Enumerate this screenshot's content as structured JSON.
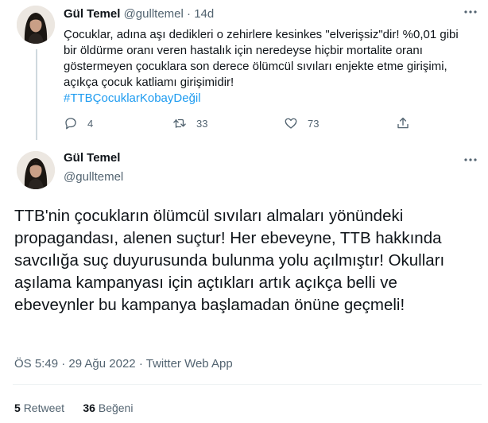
{
  "reply_tweet": {
    "author_name": "Gül Temel",
    "handle": "@gulltemel",
    "separator": "·",
    "age": "14d",
    "text_lines": [
      "Çocuklar, adına aşı dedikleri o zehirlere kesinkes \"elverişsiz\"dir! %0,01 gibi",
      "bir öldürme oranı veren hastalık için neredeyse hiçbir mortalite oranı",
      "göstermeyen çocuklara son derece ölümcül sıvıları enjekte etme girişimi,",
      "açıkça çocuk katliamı girişimidir!"
    ],
    "hashtag": "#TTBÇocuklarKobayDeğil",
    "actions": {
      "replies": "4",
      "retweets": "33",
      "likes": "73"
    },
    "icons": [
      "reply-icon",
      "retweet-icon",
      "like-icon",
      "share-icon",
      "more-icon"
    ]
  },
  "main_tweet": {
    "author_name": "Gül Temel",
    "handle": "@gulltemel",
    "text": "TTB'nin çocukların ölümcül sıvıları almaları yönündeki propagandası, alenen suçtur! Her ebeveyne, TTB hakkında savcılığa suç duyurusunda bulunma yolu açılmıştır! Okulları aşılama kampanyası için açtıkları artık açıkça belli ve ebeveynler bu kampanya başlamadan önüne geçmeli!",
    "time": "ÖS 5:49",
    "date": "29 Ağu 2022",
    "source": "Twitter Web App",
    "retweets_count": "5",
    "retweets_label": "Retweet",
    "likes_count": "36",
    "likes_label": "Beğeni"
  },
  "colors": {
    "text": "#0f1419",
    "secondary": "#536471",
    "link": "#1d9bf0",
    "divider": "#eff3f4"
  }
}
